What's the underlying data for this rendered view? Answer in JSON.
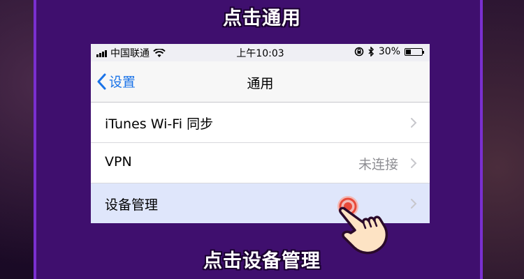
{
  "captions": {
    "top": "点击通用",
    "bottom": "点击设备管理"
  },
  "status_bar": {
    "carrier": "中国联通",
    "time": "上午10:03",
    "battery": "30%",
    "battery_level": 0.3
  },
  "nav": {
    "back_label": "设置",
    "title": "通用"
  },
  "rows": [
    {
      "label": "iTunes Wi-Fi 同步",
      "value": ""
    },
    {
      "label": "VPN",
      "value": "未连接"
    },
    {
      "label": "设备管理",
      "value": ""
    }
  ],
  "colors": {
    "panel": "#3f0f6e",
    "accent": "#1a73e8",
    "tap": "#e84a3a"
  }
}
